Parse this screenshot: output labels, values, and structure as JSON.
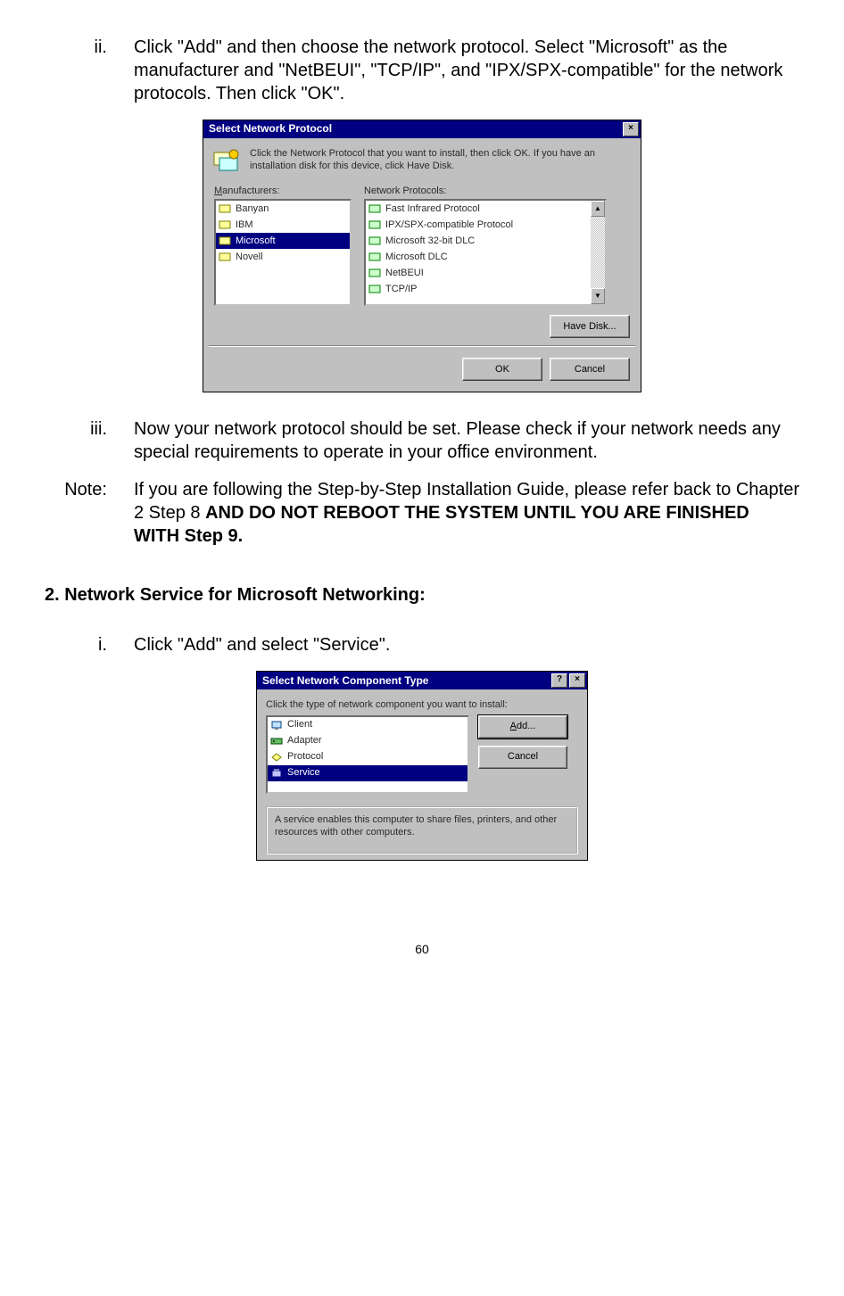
{
  "step_ii": {
    "marker": "ii.",
    "text": "Click \"Add\" and then choose the network protocol. Select \"Microsoft\" as the manufacturer and \"NetBEUI\", \"TCP/IP\", and \"IPX/SPX-compatible\" for the network protocols.  Then click \"OK\"."
  },
  "dialog1": {
    "title": "Select Network Protocol",
    "instruction": "Click the Network Protocol that you want to install, then click OK. If you have an installation disk for this device, click Have Disk.",
    "manufacturers_label": "Manufacturers:",
    "protocols_label": "Network Protocols:",
    "manufacturers": [
      "Banyan",
      "IBM",
      "Microsoft",
      "Novell"
    ],
    "selected_manufacturer_index": 2,
    "protocols": [
      "Fast Infrared Protocol",
      "IPX/SPX-compatible Protocol",
      "Microsoft 32-bit DLC",
      "Microsoft DLC",
      "NetBEUI",
      "TCP/IP"
    ],
    "have_disk": "Have Disk...",
    "ok": "OK",
    "cancel": "Cancel"
  },
  "step_iii": {
    "marker": "iii.",
    "text": "Now your network protocol should be set.  Please check if your network needs any special requirements to operate in your office environment."
  },
  "note": {
    "marker": "Note:",
    "prefix": "If you are following the Step-by-Step Installation Guide, please refer back to Chapter 2 Step 8 ",
    "bold": "AND DO NOT REBOOT THE SYSTEM UNTIL YOU ARE FINISHED WITH Step 9."
  },
  "heading2": "2. Network Service for Microsoft Networking:",
  "step_i": {
    "marker": "i.",
    "text": "Click \"Add\" and select \"Service\"."
  },
  "dialog2": {
    "title": "Select Network Component Type",
    "prompt": "Click the type of network component you want to install:",
    "items": [
      "Client",
      "Adapter",
      "Protocol",
      "Service"
    ],
    "selected_index": 3,
    "add": "Add...",
    "cancel": "Cancel",
    "description": "A service enables this computer to share files, printers, and other resources with other computers."
  },
  "page_number": "60"
}
